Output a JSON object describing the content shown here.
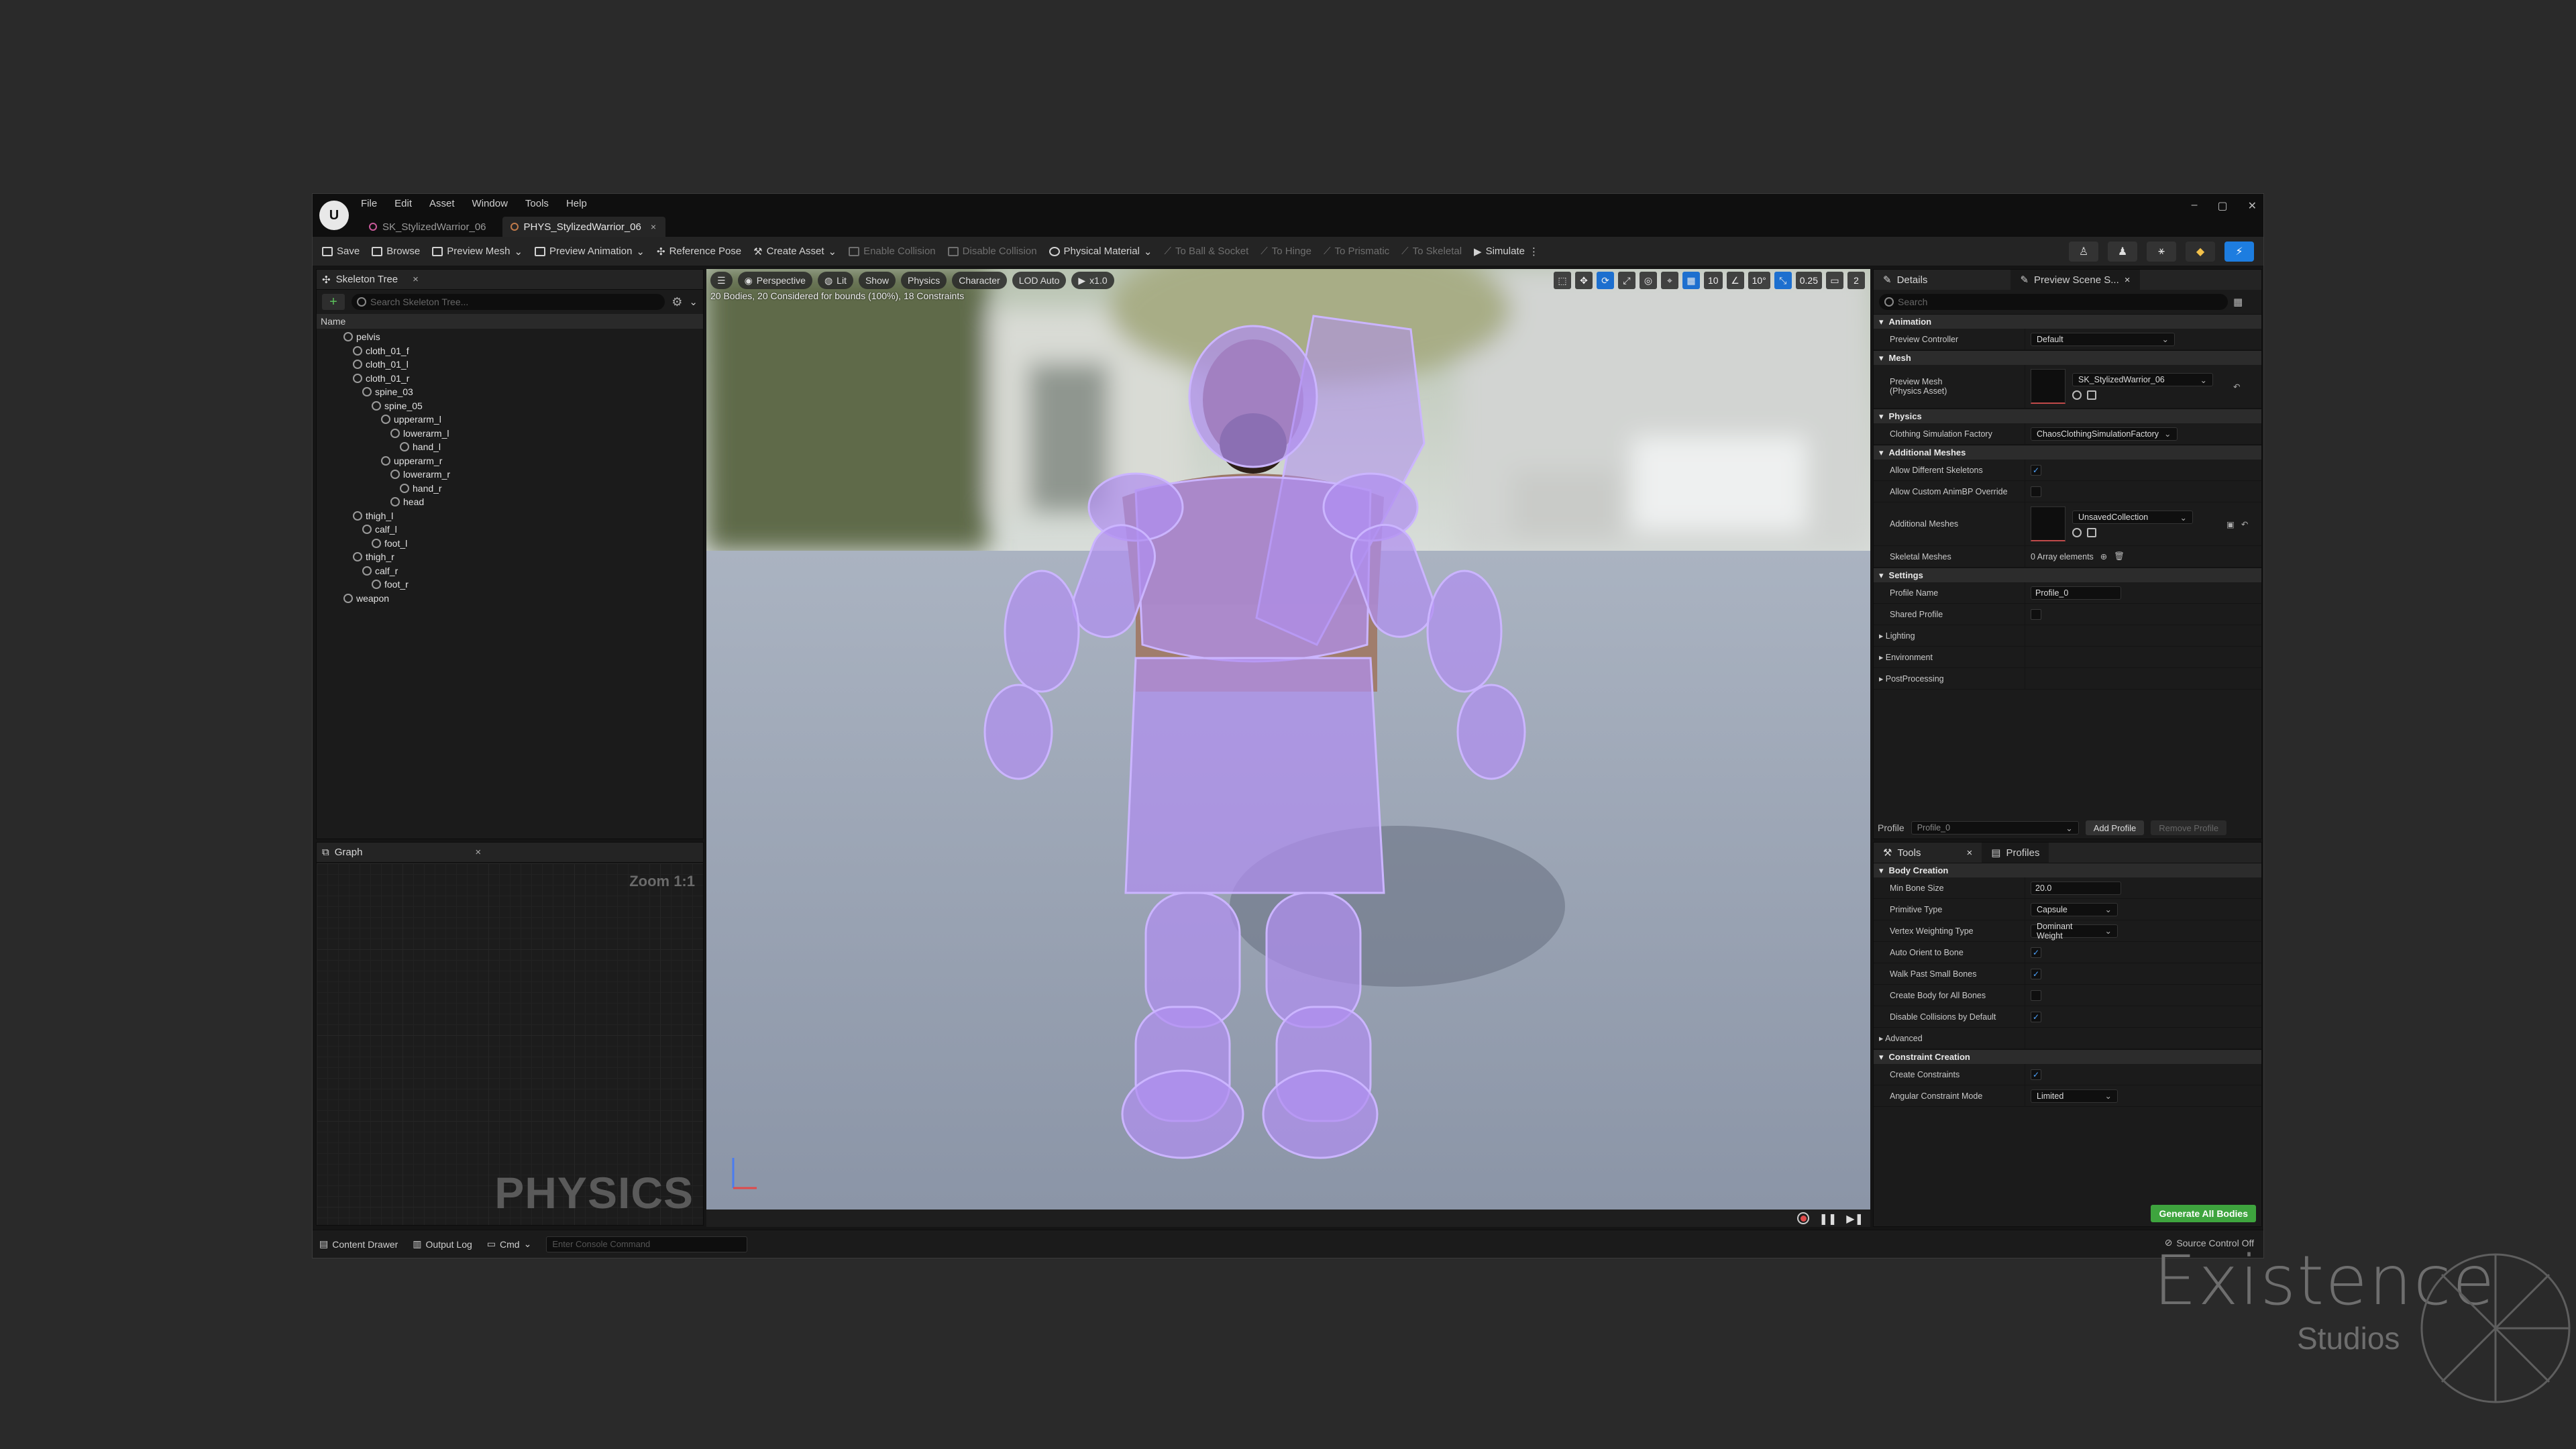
{
  "menus": [
    "File",
    "Edit",
    "Asset",
    "Window",
    "Tools",
    "Help"
  ],
  "doc_tabs": [
    {
      "label": "SK_StylizedWarrior_06"
    },
    {
      "label": "PHYS_StylizedWarrior_06",
      "close": "×"
    }
  ],
  "window_controls": {
    "min": "–",
    "max": "▢",
    "close": "✕"
  },
  "toolbar": {
    "save": "Save",
    "browse": "Browse",
    "preview_mesh": "Preview Mesh",
    "preview_animation": "Preview Animation",
    "reference_pose": "Reference Pose",
    "create_asset": "Create Asset",
    "enable_collision": "Enable Collision",
    "disable_collision": "Disable Collision",
    "physical_material": "Physical Material",
    "to_ball_socket": "To Ball & Socket",
    "to_hinge": "To Hinge",
    "to_prismatic": "To Prismatic",
    "to_skeletal": "To Skeletal",
    "simulate": "Simulate"
  },
  "skeleton_tree": {
    "title": "Skeleton Tree",
    "search_placeholder": "Search Skeleton Tree...",
    "column": "Name",
    "bones": [
      {
        "name": "pelvis",
        "depth": 0
      },
      {
        "name": "cloth_01_f",
        "depth": 1
      },
      {
        "name": "cloth_01_l",
        "depth": 1
      },
      {
        "name": "cloth_01_r",
        "depth": 1
      },
      {
        "name": "spine_03",
        "depth": 2
      },
      {
        "name": "spine_05",
        "depth": 3
      },
      {
        "name": "upperarm_l",
        "depth": 4
      },
      {
        "name": "lowerarm_l",
        "depth": 5
      },
      {
        "name": "hand_l",
        "depth": 6
      },
      {
        "name": "upperarm_r",
        "depth": 4
      },
      {
        "name": "lowerarm_r",
        "depth": 5
      },
      {
        "name": "hand_r",
        "depth": 6
      },
      {
        "name": "head",
        "depth": 5
      },
      {
        "name": "thigh_l",
        "depth": 1
      },
      {
        "name": "calf_l",
        "depth": 2
      },
      {
        "name": "foot_l",
        "depth": 3
      },
      {
        "name": "thigh_r",
        "depth": 1
      },
      {
        "name": "calf_r",
        "depth": 2
      },
      {
        "name": "foot_r",
        "depth": 3
      },
      {
        "name": "weapon",
        "depth": 0
      }
    ]
  },
  "graph": {
    "title": "Graph",
    "zoom": "Zoom 1:1",
    "watermark": "PHYSICS"
  },
  "viewport": {
    "perspective": "Perspective",
    "lit": "Lit",
    "show": "Show",
    "physics": "Physics",
    "character": "Character",
    "lod": "LOD Auto",
    "speed": "x1.0",
    "stats": "20 Bodies, 20 Considered for bounds (100%), 18 Constraints",
    "grid_snap": "10",
    "rot_snap": "10°",
    "scale_snap": "0.25",
    "cam_speed": "2"
  },
  "details": {
    "tab_details": "Details",
    "tab_preview": "Preview Scene S...",
    "search_placeholder": "Search",
    "animation_section": "Animation",
    "preview_controller_label": "Preview Controller",
    "preview_controller_value": "Default",
    "mesh_section": "Mesh",
    "preview_mesh_label": "Preview Mesh\n(Physics Asset)",
    "preview_mesh_value": "SK_StylizedWarrior_06",
    "physics_section": "Physics",
    "clothing_label": "Clothing Simulation Factory",
    "clothing_value": "ChaosClothingSimulationFactory",
    "additional_meshes_section": "Additional Meshes",
    "allow_diff_skeletons": "Allow Different Skeletons",
    "allow_custom_animbp": "Allow Custom AnimBP Override",
    "additional_meshes_label": "Additional Meshes",
    "additional_meshes_value": "UnsavedCollection",
    "skeletal_meshes_label": "Skeletal Meshes",
    "skeletal_meshes_value": "0 Array elements",
    "settings_section": "Settings",
    "profile_name_label": "Profile Name",
    "profile_name_value": "Profile_0",
    "shared_profile_label": "Shared Profile",
    "lighting": "Lighting",
    "environment": "Environment",
    "postprocessing": "PostProcessing",
    "profile_label": "Profile",
    "profile_value": "Profile_0",
    "add_profile": "Add Profile",
    "remove_profile": "Remove Profile"
  },
  "tools": {
    "tab_tools": "Tools",
    "tab_profiles": "Profiles",
    "body_creation": "Body Creation",
    "min_bone_size_label": "Min Bone Size",
    "min_bone_size_value": "20.0",
    "primitive_type_label": "Primitive Type",
    "primitive_type_value": "Capsule",
    "vertex_weighting_label": "Vertex Weighting Type",
    "vertex_weighting_value": "Dominant Weight",
    "auto_orient_label": "Auto Orient to Bone",
    "walk_past_label": "Walk Past Small Bones",
    "create_body_all_label": "Create Body for All Bones",
    "disable_collisions_label": "Disable Collisions by Default",
    "advanced": "Advanced",
    "constraint_creation": "Constraint Creation",
    "create_constraints_label": "Create Constraints",
    "angular_mode_label": "Angular Constraint Mode",
    "angular_mode_value": "Limited",
    "generate_button": "Generate All Bodies"
  },
  "statusbar": {
    "content_drawer": "Content Drawer",
    "output_log": "Output Log",
    "cmd": "Cmd",
    "console_placeholder": "Enter Console Command",
    "source_control": "Source Control Off"
  },
  "watermark": {
    "main": "Existence",
    "sub": "Studios"
  },
  "colors": {
    "accent_blue": "#1d7de0",
    "generate_green": "#3ea43e",
    "physics_body": "#b694ff"
  }
}
